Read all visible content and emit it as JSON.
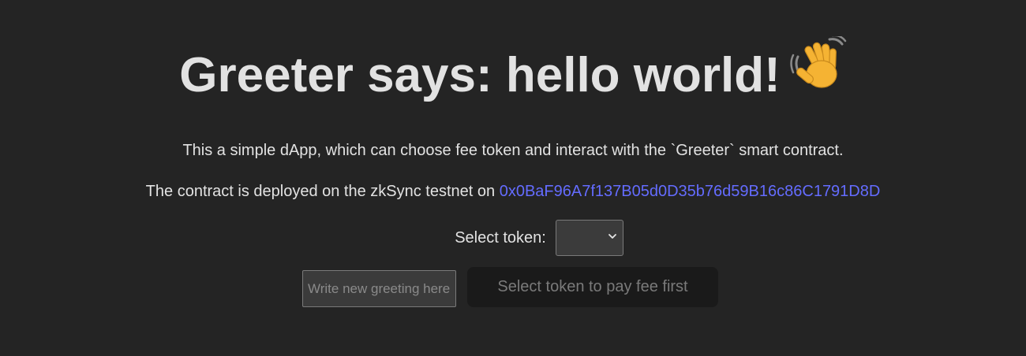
{
  "header": {
    "title": "Greeter says: hello world!",
    "emoji_icon": "waving-hand-icon"
  },
  "intro": {
    "description": "This a simple dApp, which can choose fee token and interact with the `Greeter` smart contract.",
    "deployed_prefix": "The contract is deployed on the zkSync testnet on",
    "contract_address": "0x0BaF96A7f137B05d0D35b76d59B16c86C1791D8D"
  },
  "token": {
    "label": "Select token:",
    "selected": ""
  },
  "greeting": {
    "placeholder": "Write new greeting here...",
    "value": ""
  },
  "actions": {
    "pay_button_label": "Select token to pay fee first",
    "pay_button_disabled": true
  },
  "colors": {
    "background": "#242424",
    "text": "#e6e6e6",
    "link": "#646cff",
    "button_bg": "#1a1a1a",
    "input_bg": "#3b3b3b"
  }
}
